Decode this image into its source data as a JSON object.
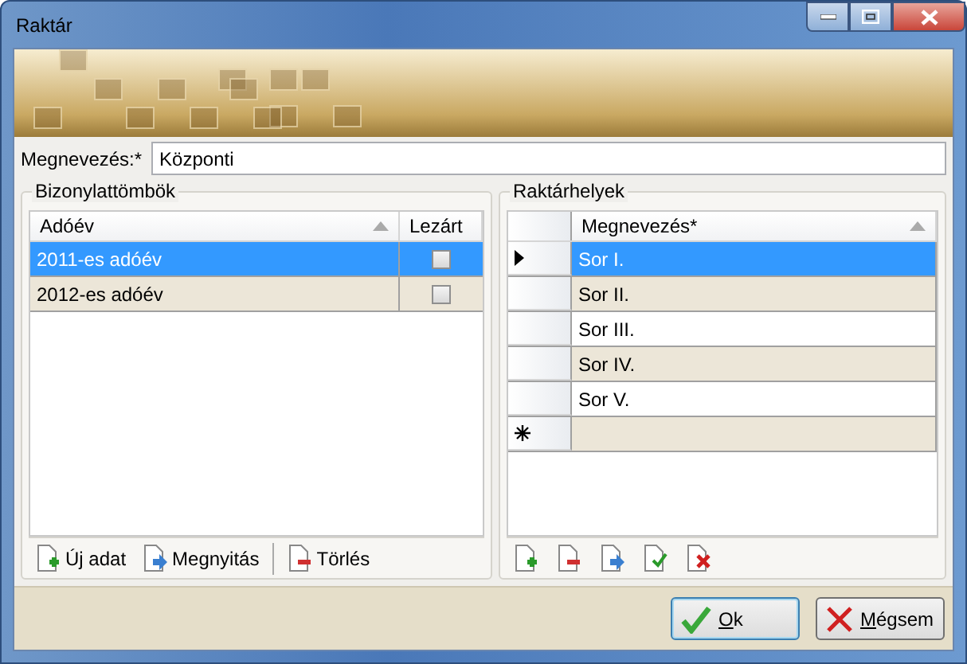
{
  "window": {
    "title": "Raktár"
  },
  "name_field": {
    "label": "Megnevezés:*",
    "value": "Központi"
  },
  "left_panel": {
    "title": "Bizonylattömbök",
    "columns": [
      {
        "label": "Adóév",
        "sorted": true
      },
      {
        "label": "Lezárt",
        "sorted": false
      }
    ],
    "rows": [
      {
        "name": "2011-es adóév",
        "closed": false,
        "selected": true
      },
      {
        "name": "2012-es adóév",
        "closed": false,
        "selected": false
      }
    ],
    "toolbar": [
      {
        "label": "Új adat",
        "kind": "add",
        "separator_before": false
      },
      {
        "label": "Megnyitás",
        "kind": "open",
        "separator_before": false
      },
      {
        "label": "Törlés",
        "kind": "delete",
        "separator_before": true
      }
    ]
  },
  "right_panel": {
    "title": "Raktárhelyek",
    "columns": [
      {
        "label": "Megnevezés*",
        "sorted": true
      }
    ],
    "rows": [
      {
        "name": "Sor I.",
        "selected": true
      },
      {
        "name": "Sor II.",
        "selected": false
      },
      {
        "name": "Sor III.",
        "selected": false
      },
      {
        "name": "Sor IV.",
        "selected": false
      },
      {
        "name": "Sor V.",
        "selected": false
      }
    ],
    "new_row": true,
    "toolbar": [
      {
        "kind": "add"
      },
      {
        "kind": "delete"
      },
      {
        "kind": "open"
      },
      {
        "kind": "check"
      },
      {
        "kind": "remove"
      }
    ]
  },
  "buttons": [
    {
      "label": "Ok",
      "kind": "ok",
      "focused": true
    },
    {
      "label": "Mégsem",
      "kind": "cancel",
      "focused": false
    }
  ]
}
